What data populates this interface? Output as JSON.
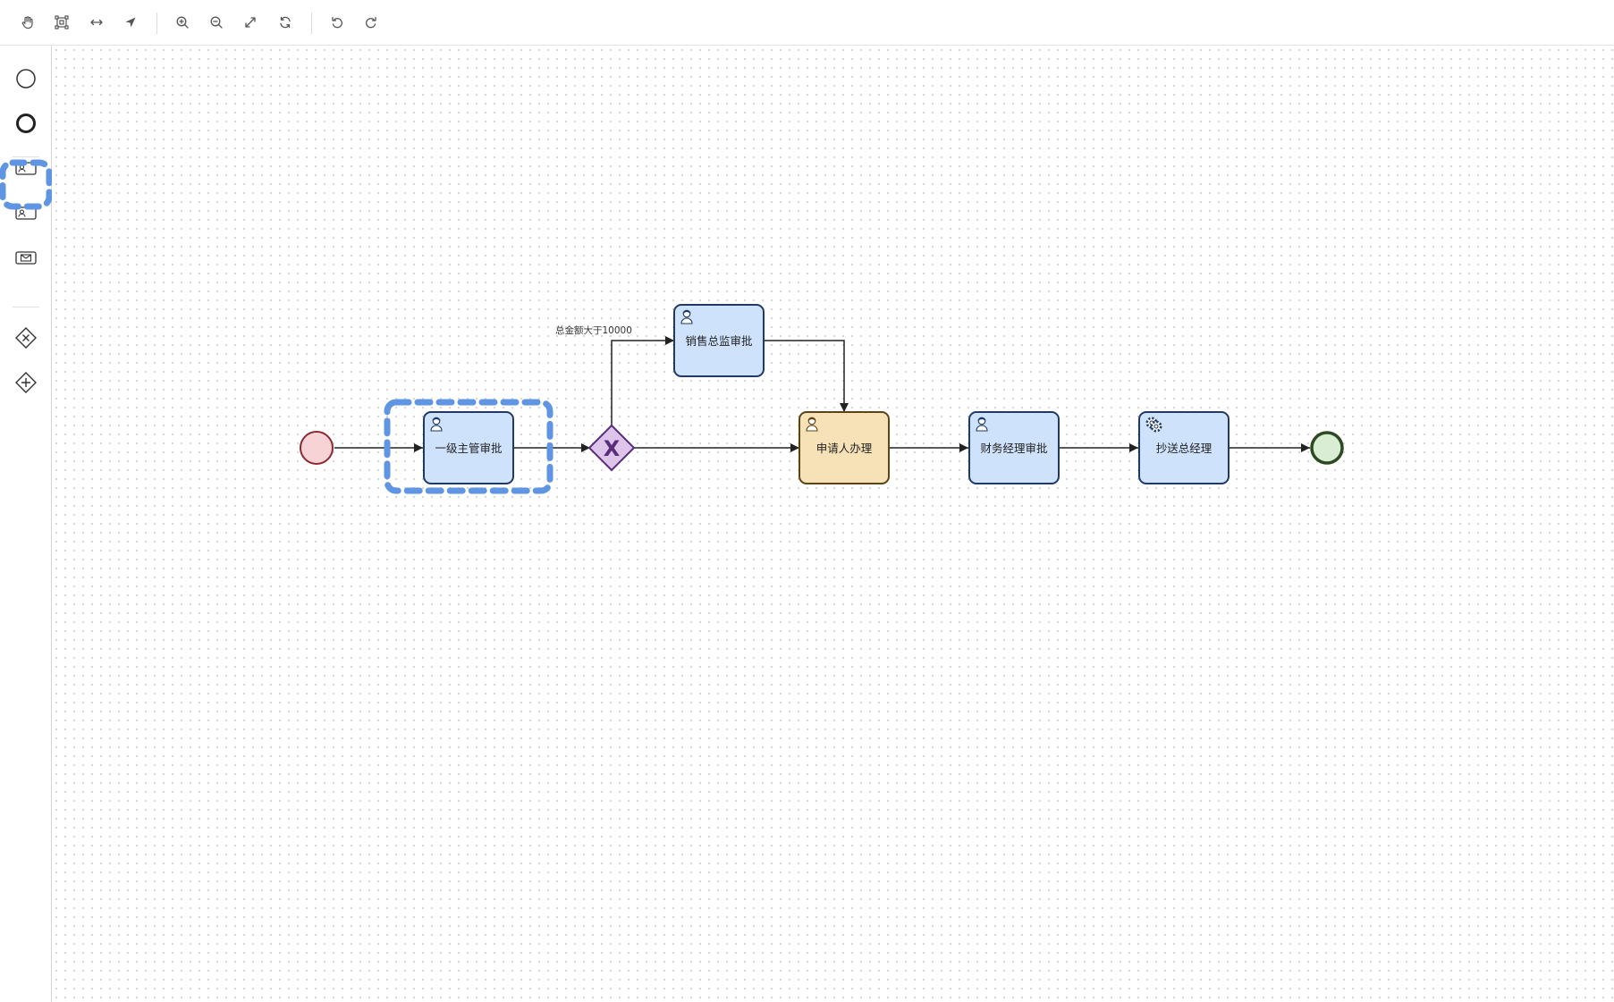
{
  "toolbar": {
    "icons": [
      "hand-icon",
      "lasso-select-icon",
      "space-tool-icon",
      "connect-tool-icon",
      "zoom-in-icon",
      "zoom-out-icon",
      "fit-view-icon",
      "reset-icon",
      "undo-icon",
      "redo-icon"
    ]
  },
  "palette": {
    "items": [
      "start-event",
      "end-event",
      "user-task",
      "user-task-2",
      "message-task",
      "exclusive-gateway",
      "parallel-gateway"
    ],
    "selected": "user-task"
  },
  "diagram": {
    "start_event": {
      "label": ""
    },
    "tasks": {
      "level1": {
        "label": "一级主管审批",
        "icon": "user-icon",
        "fill": "#cfe2fb",
        "stroke": "#1f3a66"
      },
      "sales": {
        "label": "销售总监审批",
        "icon": "user-icon",
        "fill": "#cfe2fb",
        "stroke": "#1f3a66"
      },
      "applicant": {
        "label": "申请人办理",
        "icon": "user-icon",
        "fill": "#f7e2b8",
        "stroke": "#5c4416"
      },
      "finance": {
        "label": "财务经理审批",
        "icon": "user-icon",
        "fill": "#cfe2fb",
        "stroke": "#1f3a66"
      },
      "cc": {
        "label": "抄送总经理",
        "icon": "service-gear-icon",
        "fill": "#cfe2fb",
        "stroke": "#1f3a66"
      }
    },
    "gateway": {
      "type": "exclusive",
      "symbol": "X",
      "fill": "#dcc4ea",
      "stroke": "#5a2d7a"
    },
    "condition_label": "总金额大于10000",
    "end_event": {
      "label": "",
      "fill": "#d9ecd4",
      "stroke": "#2d4a23"
    },
    "start_colors": {
      "fill": "#f7d3d6",
      "stroke": "#8a2a33"
    },
    "selection_color": "#5f95e3"
  }
}
